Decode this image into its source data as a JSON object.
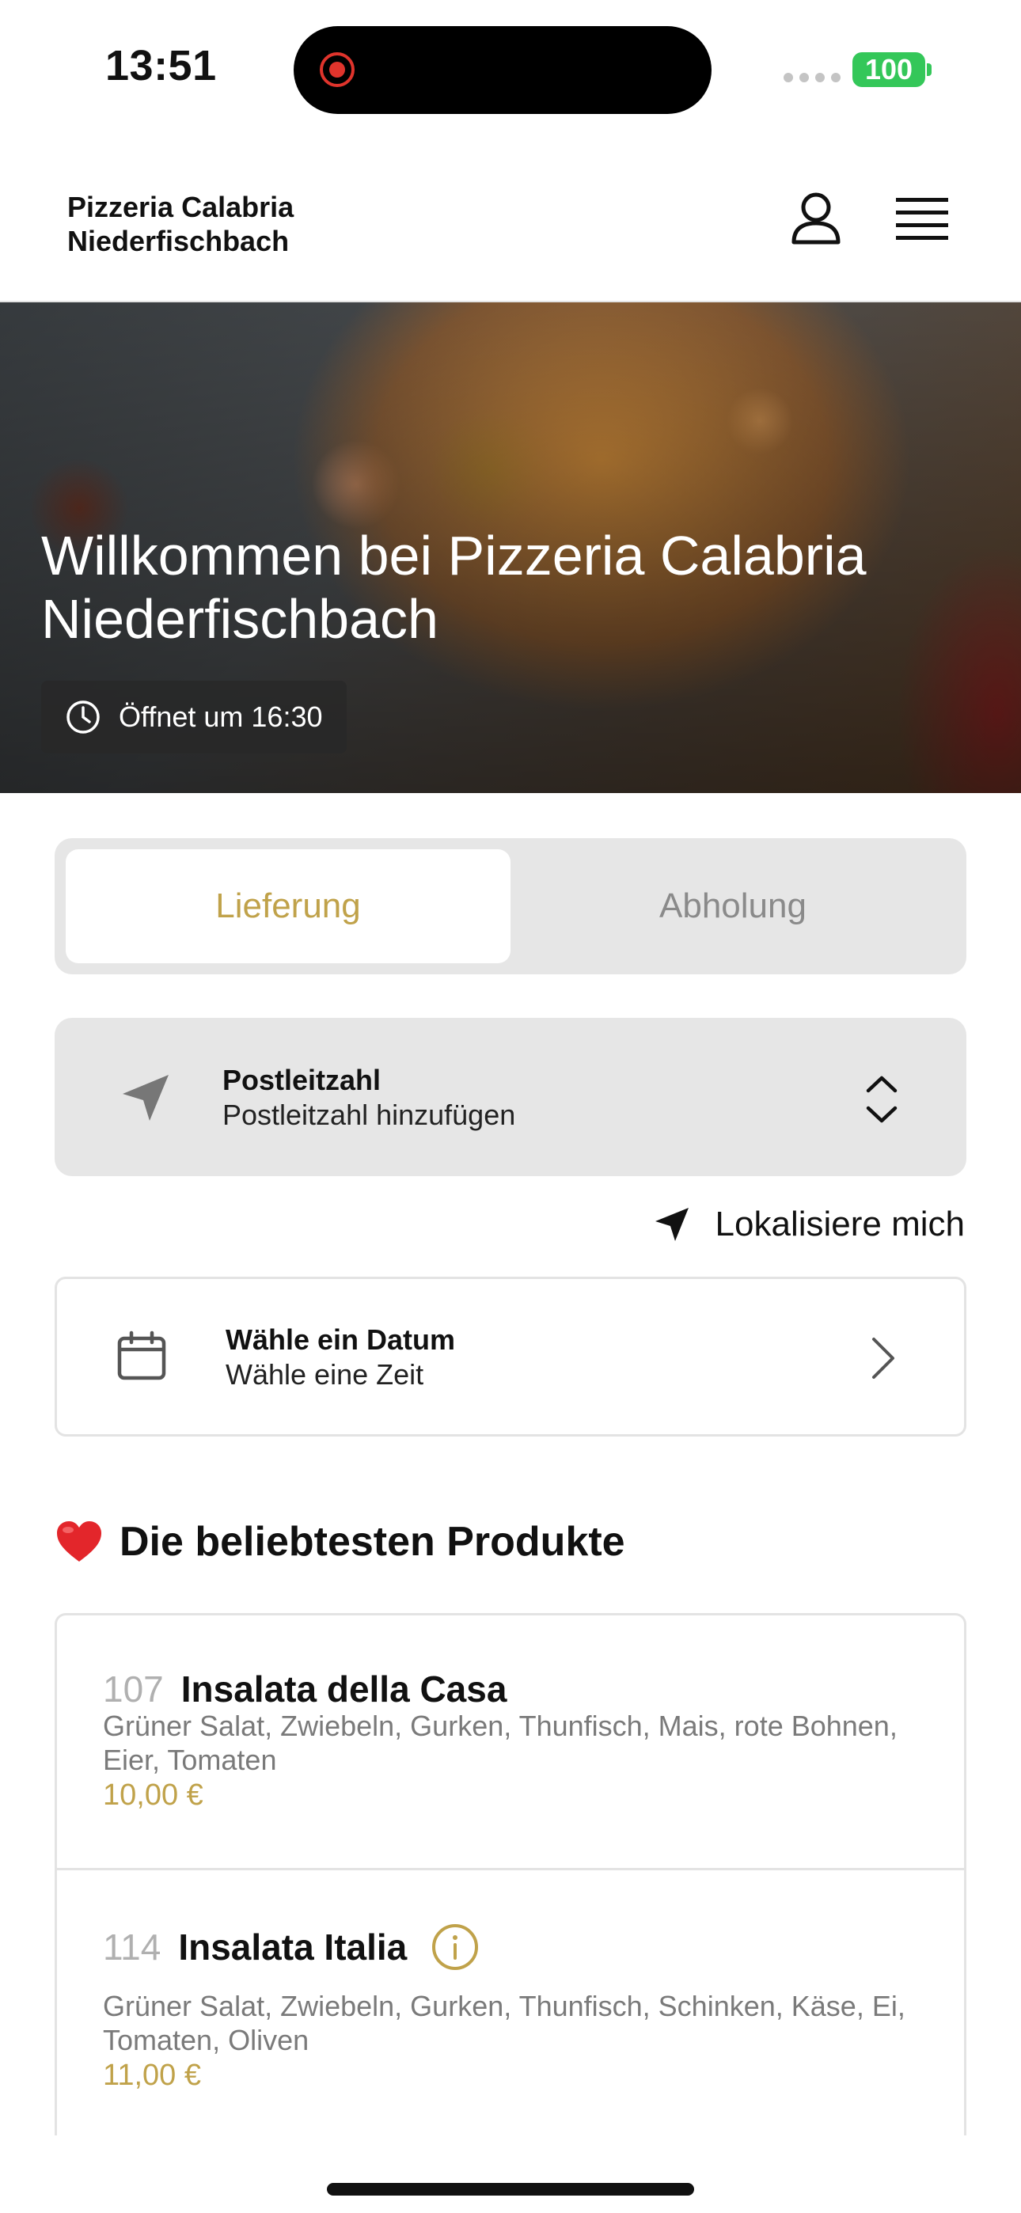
{
  "status_bar": {
    "time": "13:51",
    "battery": "100",
    "battery_color": "#34c759"
  },
  "header": {
    "shop_name_line1": "Pizzeria Calabria",
    "shop_name_line2": "Niederfischbach",
    "profile_icon": "user-icon",
    "menu_icon": "hamburger-menu-icon"
  },
  "hero": {
    "title": "Willkommen bei Pizzeria Calabria Niederfischbach",
    "open_status": "Öffnet um 16:30"
  },
  "order_mode": {
    "options": [
      "Lieferung",
      "Abholung"
    ],
    "selected": "Lieferung"
  },
  "postcode": {
    "label": "Postleitzahl",
    "placeholder": "Postleitzahl hinzufügen"
  },
  "locate": {
    "label": "Lokalisiere mich"
  },
  "schedule": {
    "date_label": "Wähle ein Datum",
    "time_label": "Wähle eine Zeit"
  },
  "popular": {
    "title": "Die beliebtesten Produkte",
    "products": [
      {
        "number": "107",
        "name": "Insalata della Casa",
        "description": "Grüner Salat, Zwiebeln, Gurken, Thunfisch, Mais, rote Bohnen, Eier, Tomaten",
        "price": "10,00 €"
      },
      {
        "number": "114",
        "name": "Insalata Italia",
        "description": "Grüner Salat, Zwiebeln, Gurken, Thunfisch, Schinken, Käse, Ei, Tomaten, Oliven",
        "price": "11,00 €"
      }
    ]
  },
  "colors": {
    "accent_gold": "#c0a24a",
    "field_gray": "#e6e6e6"
  }
}
